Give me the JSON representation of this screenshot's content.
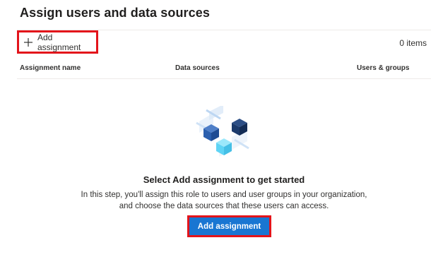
{
  "page": {
    "title": "Assign users and data sources"
  },
  "toolbar": {
    "add_assignment_label": "Add assignment",
    "add_icon": "plus-icon",
    "item_count": "0 items"
  },
  "table": {
    "columns": [
      "Assignment name",
      "Data sources",
      "Users & groups"
    ]
  },
  "empty_state": {
    "illustration_icon": "isometric-cubes-illustration",
    "title": "Select Add assignment to get started",
    "description_line1": "In this step, you'll assign this role to users and user groups in your organization,",
    "description_line2": "and choose the data sources that these users can access.",
    "button_label": "Add assignment"
  },
  "colors": {
    "primary": "#1976d2",
    "highlight_border": "#e3141b",
    "cube_dark_navy": "#1b3a6b",
    "cube_blue": "#2b5fae",
    "cube_light": "#5fd4f5"
  }
}
